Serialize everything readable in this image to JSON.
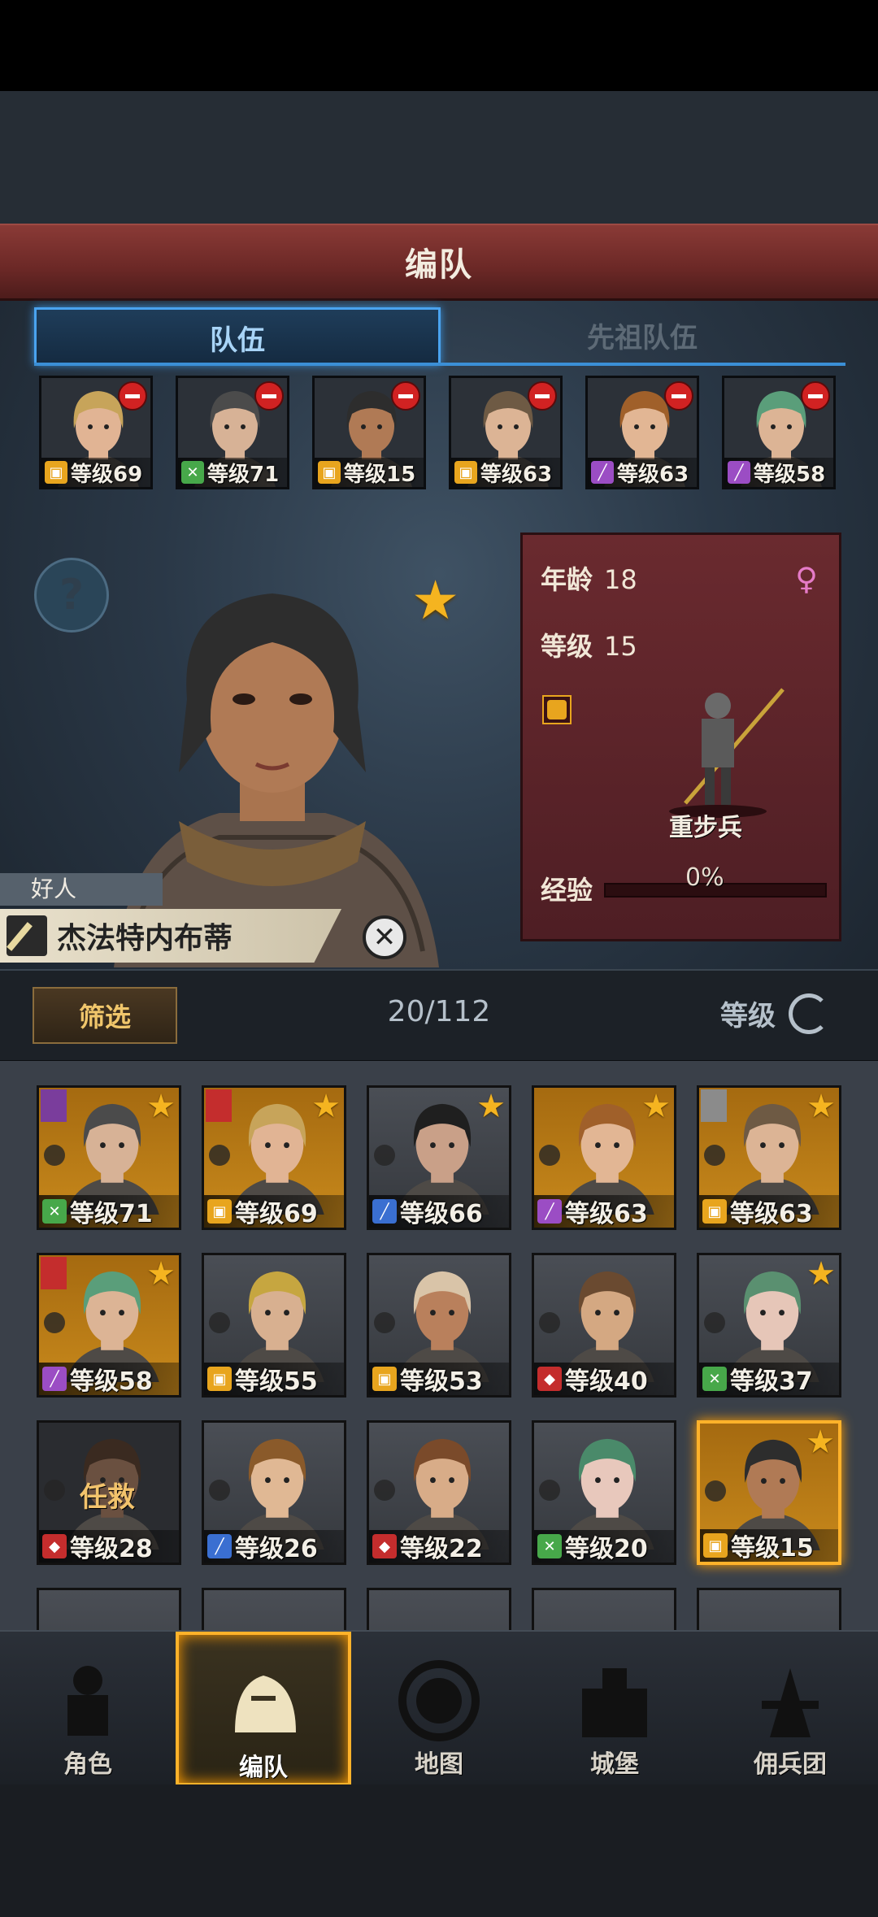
{
  "header": {
    "title": "编队"
  },
  "tabs": [
    {
      "label": "队伍"
    },
    {
      "label": "先祖队伍"
    }
  ],
  "team": [
    {
      "level": "等级69",
      "class": "shield",
      "hair": "#c7a45a",
      "skin": "#e1b494"
    },
    {
      "level": "等级71",
      "class": "bow",
      "hair": "#4b4b4b",
      "skin": "#d7b296"
    },
    {
      "level": "等级15",
      "class": "shield",
      "hair": "#2d2d2d",
      "skin": "#b07a55"
    },
    {
      "level": "等级63",
      "class": "shield",
      "hair": "#6e5a44",
      "skin": "#dcb495"
    },
    {
      "level": "等级63",
      "class": "staff",
      "hair": "#a0602a",
      "skin": "#e2b694"
    },
    {
      "level": "等级58",
      "class": "staff",
      "hair": "#5a9e7a",
      "skin": "#dcb495"
    }
  ],
  "hero": {
    "age_label": "年龄",
    "age": "18",
    "level_label": "等级",
    "level": "15",
    "unit_type": "重步兵",
    "exp_label": "经验",
    "exp_value": "0%",
    "trait": "好人",
    "name": "杰法特内布蒂"
  },
  "filter": {
    "label": "筛选",
    "count": "20/112",
    "sort_label": "等级"
  },
  "roster": [
    {
      "level": "等级71",
      "class": "bow",
      "bg": "gold",
      "star": true,
      "hair": "#4b4b4b",
      "skin": "#d7b296",
      "faction": "#7a3d9c"
    },
    {
      "level": "等级69",
      "class": "shield",
      "bg": "gold",
      "star": true,
      "hair": "#c7a45a",
      "skin": "#e1b494",
      "faction": "#c42d2d"
    },
    {
      "level": "等级66",
      "class": "sword",
      "bg": "grey",
      "star": true,
      "hair": "#1f1f1f",
      "skin": "#c9a088"
    },
    {
      "level": "等级63",
      "class": "staff",
      "bg": "gold",
      "star": true,
      "hair": "#a0602a",
      "skin": "#e2b694"
    },
    {
      "level": "等级63",
      "class": "shield",
      "bg": "gold",
      "star": true,
      "hair": "#6e5a44",
      "skin": "#dcb495",
      "faction": "#8b8b8b"
    },
    {
      "level": "等级58",
      "class": "staff",
      "bg": "gold",
      "star": true,
      "hair": "#5a9e7a",
      "skin": "#dcb495",
      "faction": "#c42d2d"
    },
    {
      "level": "等级55",
      "class": "shield",
      "bg": "grey",
      "star": false,
      "hair": "#c6a640",
      "skin": "#d8b090"
    },
    {
      "level": "等级53",
      "class": "shield",
      "bg": "grey",
      "star": false,
      "hair": "#d9c4a8",
      "skin": "#b9805c"
    },
    {
      "level": "等级40",
      "class": "beast",
      "bg": "grey",
      "star": false,
      "hair": "#6a4a30",
      "skin": "#d4a882"
    },
    {
      "level": "等级37",
      "class": "bow",
      "bg": "grey",
      "star": true,
      "hair": "#5a9070",
      "skin": "#e6c6b8"
    },
    {
      "level": "等级28",
      "class": "beast",
      "bg": "dim",
      "star": false,
      "hair": "#3a2a20",
      "skin": "#6a5040",
      "status": "任救"
    },
    {
      "level": "等级26",
      "class": "sword",
      "bg": "grey",
      "star": false,
      "hair": "#8a5a2a",
      "skin": "#e0b894"
    },
    {
      "level": "等级22",
      "class": "beast",
      "bg": "grey",
      "star": false,
      "hair": "#7a4a2a",
      "skin": "#d8ac88"
    },
    {
      "level": "等级20",
      "class": "bow",
      "bg": "grey",
      "star": false,
      "hair": "#4a8a6a",
      "skin": "#e8c8bc"
    },
    {
      "level": "等级15",
      "class": "shield",
      "bg": "gold",
      "star": true,
      "hair": "#2d2d2d",
      "skin": "#b07a55",
      "selected": true
    }
  ],
  "nav": [
    {
      "label": "角色",
      "icon": "knight-icon"
    },
    {
      "label": "编队",
      "icon": "helmet-icon",
      "active": true
    },
    {
      "label": "地图",
      "icon": "compass-icon"
    },
    {
      "label": "城堡",
      "icon": "castle-icon"
    },
    {
      "label": "佣兵团",
      "icon": "mercenary-icon"
    }
  ]
}
